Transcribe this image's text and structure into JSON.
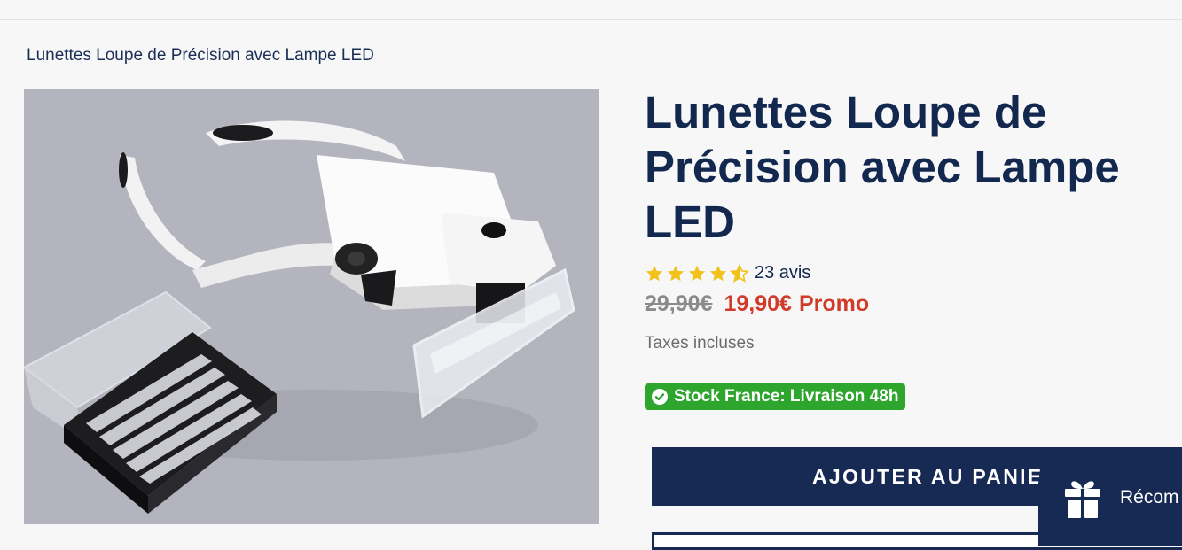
{
  "breadcrumb": "Lunettes Loupe de Précision avec Lampe LED",
  "product": {
    "image_alt": "Lunettes loupe blanches avec lampe LED et coffret de lentilles",
    "title": "Lunettes Loupe de Précision avec Lampe LED",
    "rating": {
      "stars": 4.5,
      "max": 5,
      "count_label": "23 avis",
      "star_color": "#f2c21a"
    },
    "old_price": "29,90€",
    "new_price": "19,90€",
    "promo_label": "Promo",
    "tax_note": "Taxes incluses",
    "stock_badge": "Stock France: Livraison 48h",
    "add_to_cart_label": "AJOUTER AU PANIE"
  },
  "rewards_widget": {
    "label": "Récom",
    "icon": "gift-icon"
  },
  "colors": {
    "navy": "#172a53",
    "promo_red": "#d13b2a",
    "stock_green": "#2ea52d"
  }
}
